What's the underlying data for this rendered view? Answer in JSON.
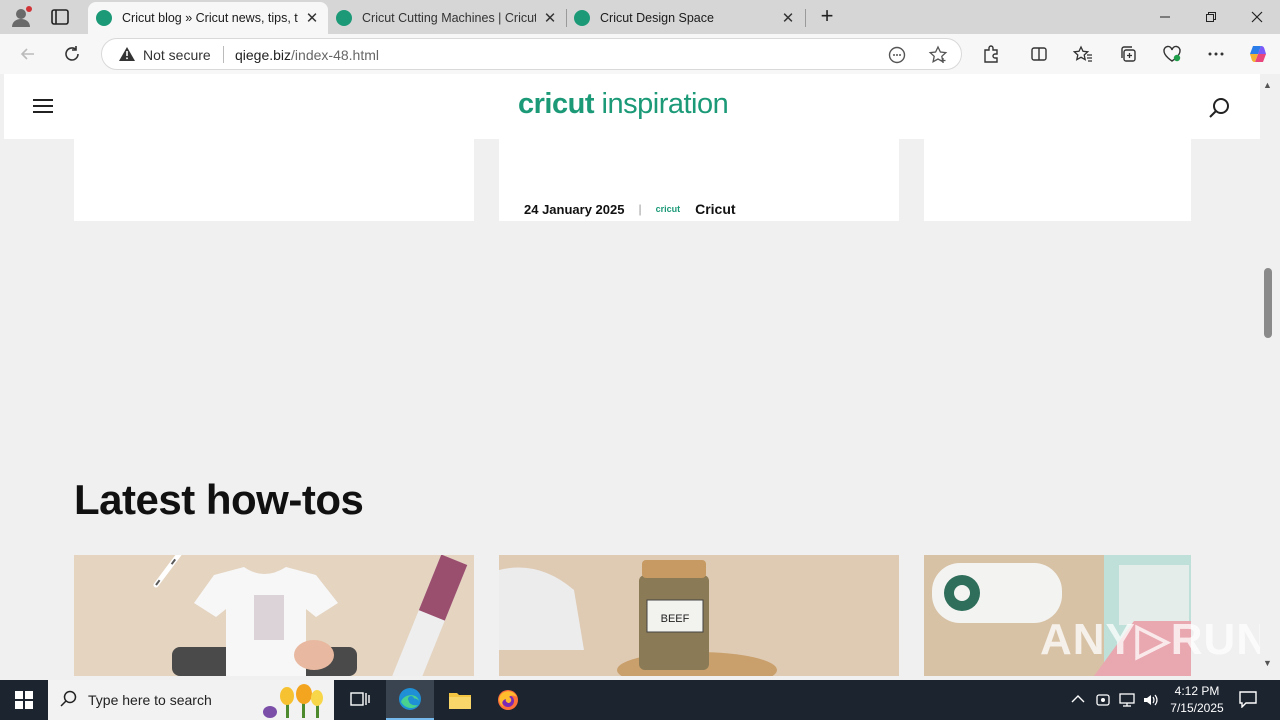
{
  "browser": {
    "tabs": [
      {
        "title": "Cricut blog » Cricut news, tips, tric",
        "active": true,
        "favicon_color": "#1c9a78"
      },
      {
        "title": "Cricut Cutting Machines | Cricut S",
        "active": false,
        "favicon_color": "#1c9a78"
      },
      {
        "title": "Cricut Design Space",
        "active": false,
        "favicon_color": "#1c9a78"
      }
    ],
    "close_glyph": "✕",
    "new_tab_glyph": "+",
    "address": {
      "security_label": "Not secure",
      "host": "qiege.biz",
      "path": "/index-48.html"
    }
  },
  "site": {
    "logo_bold": "cricut",
    "logo_light": "inspiration",
    "brand_color": "#1c9a78",
    "article_meta": {
      "date": "24 January 2025",
      "separator": "|",
      "mini_logo": "cricut",
      "author": "Cricut"
    },
    "section_title": "Latest how-tos"
  },
  "watermark": "ANY▷RUN",
  "taskbar": {
    "search_placeholder": "Type here to search",
    "time": "4:12 PM",
    "date": "7/15/2025"
  }
}
